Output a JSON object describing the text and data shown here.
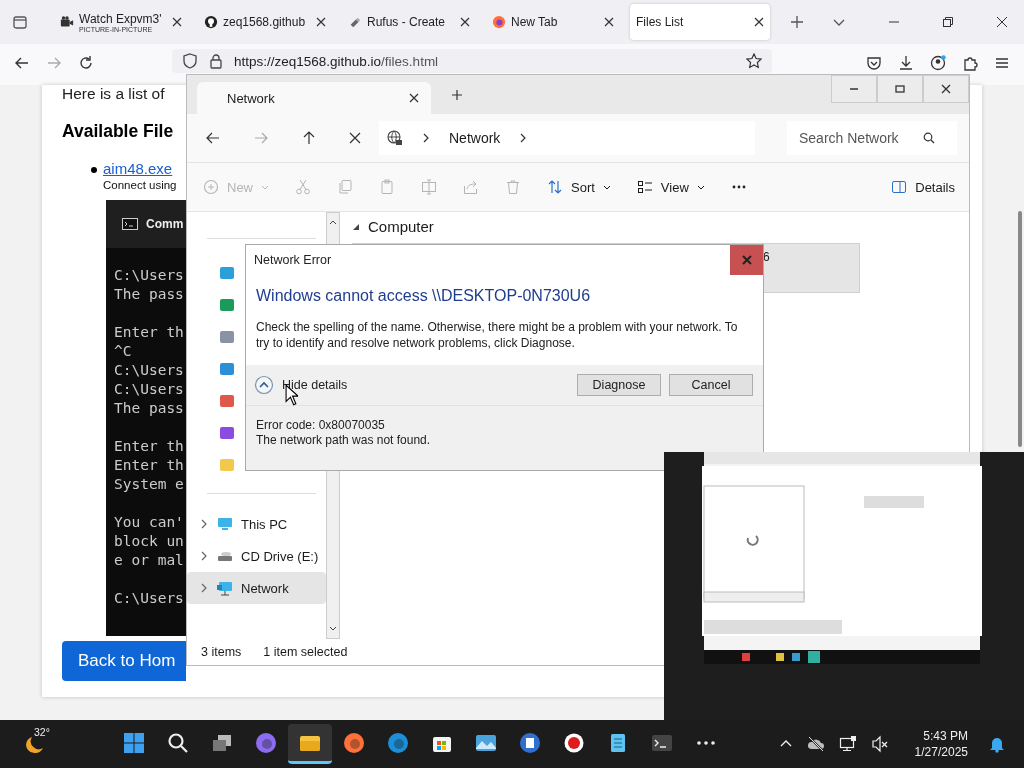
{
  "browser": {
    "tabs": [
      {
        "kind": "video",
        "title": "Watch Expvm3'",
        "subtitle": "PICTURE-IN-PICTURE",
        "selected": false
      },
      {
        "kind": "github",
        "title": "zeq1568.github",
        "selected": false
      },
      {
        "kind": "rufus",
        "title": "Rufus - Create",
        "selected": false
      },
      {
        "kind": "firefox",
        "title": "New Tab",
        "selected": false
      },
      {
        "kind": "page",
        "title": "Files List",
        "selected": true
      }
    ],
    "url_host": "https://zeq1568.github.io",
    "url_path": "/files.html"
  },
  "page": {
    "intro": "Here is a list of",
    "heading": "Available File",
    "files": [
      {
        "name": "aim48.exe",
        "description": "Connect using"
      }
    ],
    "back_button": "Back to Hom"
  },
  "cmd": {
    "title": "Comm",
    "blocks": [
      [
        "C:\\Users",
        "The pass"
      ],
      [
        "Enter th",
        "^C",
        "C:\\Users",
        "C:\\Users",
        "The pass"
      ],
      [
        "Enter th",
        "Enter th",
        "System e"
      ],
      [
        "You can'",
        "block un",
        "e or mal"
      ],
      [
        "C:\\Users"
      ]
    ]
  },
  "explorer": {
    "tab": "Network",
    "breadcrumb": "Network",
    "search_placeholder": "Search Network",
    "commands": [
      {
        "kind": "new",
        "label": "New",
        "disabled": true
      },
      {
        "kind": "cut",
        "disabled": true
      },
      {
        "kind": "copy",
        "disabled": true
      },
      {
        "kind": "paste",
        "disabled": true
      },
      {
        "kind": "rename",
        "disabled": true
      },
      {
        "kind": "share",
        "disabled": true
      },
      {
        "kind": "delete",
        "disabled": true
      },
      {
        "kind": "sort",
        "label": "Sort",
        "disabled": false
      },
      {
        "kind": "view",
        "label": "View",
        "disabled": false
      },
      {
        "kind": "more",
        "disabled": false
      }
    ],
    "details_button": "Details",
    "quick_access": [
      {
        "kind": "desktop"
      },
      {
        "kind": "download"
      },
      {
        "kind": "document"
      },
      {
        "kind": "pictures"
      },
      {
        "kind": "music"
      },
      {
        "kind": "videos"
      },
      {
        "kind": "folder"
      }
    ],
    "drives": [
      {
        "kind": "pc",
        "label": "This PC",
        "selected": false
      },
      {
        "kind": "cd",
        "label": "CD Drive (E:)",
        "selected": false
      },
      {
        "kind": "network",
        "label": "Network",
        "selected": true
      }
    ],
    "group": "Computer",
    "items": [
      {
        "label": "6",
        "selected": true
      }
    ],
    "status": {
      "count": "3 items",
      "selection": "1 item selected"
    }
  },
  "dialog": {
    "title": "Network Error",
    "heading": "Windows cannot access \\\\DESKTOP-0N730U6",
    "message": "Check the spelling of the name. Otherwise, there might be a problem with your network. To try to identify and resolve network problems, click Diagnose.",
    "details_toggle": "Hide details",
    "expanded": true,
    "buttons": [
      "Diagnose",
      "Cancel"
    ],
    "details": [
      "Error code: 0x80070035",
      "The network path was not found."
    ]
  },
  "taskbar": {
    "temperature": "32°",
    "apps": [
      {
        "kind": "start",
        "active": false
      },
      {
        "kind": "search",
        "active": false
      },
      {
        "kind": "taskview",
        "active": false
      },
      {
        "kind": "copilot",
        "active": false
      },
      {
        "kind": "explorer",
        "active": true
      },
      {
        "kind": "firefox",
        "active": false
      },
      {
        "kind": "edge",
        "active": false
      },
      {
        "kind": "store",
        "active": false
      },
      {
        "kind": "photos",
        "active": false
      },
      {
        "kind": "disk",
        "active": false
      },
      {
        "kind": "record",
        "active": false
      },
      {
        "kind": "notepad",
        "active": false
      },
      {
        "kind": "terminal",
        "active": false
      },
      {
        "kind": "more",
        "active": false
      }
    ],
    "time": "5:43 PM",
    "date": "1/27/2025"
  }
}
